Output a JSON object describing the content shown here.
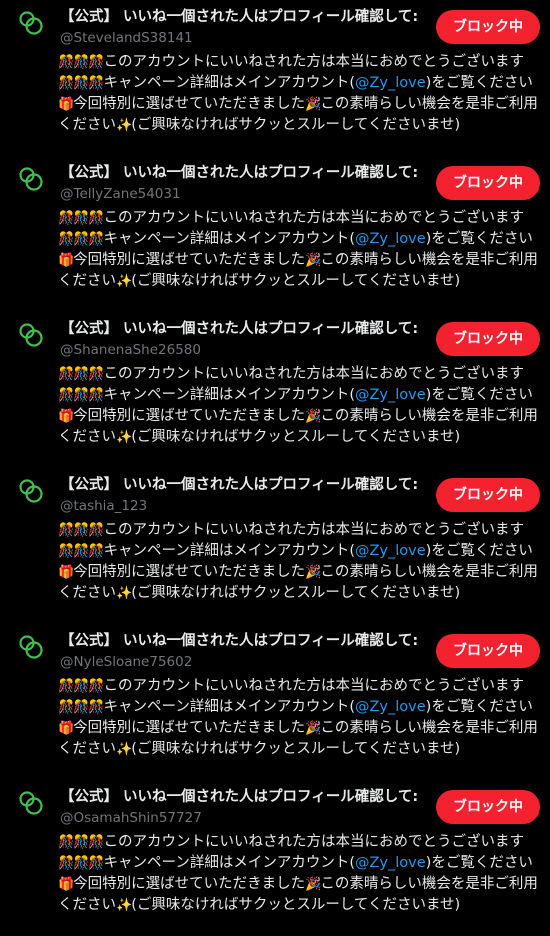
{
  "accounts": [
    {
      "name": "【公式】 いいね一個された人はプロフィール確認して:",
      "handle": "@StevelandS38141",
      "button_label": "ブロック中"
    },
    {
      "name": "【公式】 いいね一個された人はプロフィール確認して:",
      "handle": "@TellyZane54031",
      "button_label": "ブロック中"
    },
    {
      "name": "【公式】 いいね一個された人はプロフィール確認して:",
      "handle": "@ShanenaShe26580",
      "button_label": "ブロック中"
    },
    {
      "name": "【公式】 いいね一個された人はプロフィール確認して:",
      "handle": "@tashia_123",
      "button_label": "ブロック中"
    },
    {
      "name": "【公式】 いいね一個された人はプロフィール確認して:",
      "handle": "@NyleSloane75602",
      "button_label": "ブロック中"
    },
    {
      "name": "【公式】 いいね一個された人はプロフィール確認して:",
      "handle": "@OsamahShin57727",
      "button_label": "ブロック中"
    }
  ],
  "bio": {
    "emoji_balloons": "🎊🎊🎊",
    "part1": "このアカウントにいいねされた方は本当におめでとうございます",
    "part2": "キャンペーン詳細はメインアカウント(",
    "mention": "@Zy_love",
    "part3": ")をご覧ください",
    "emoji_gift": "🎁",
    "part4": "今回特別に選ばせていただきました",
    "emoji_party": "🎉",
    "part5": "この素晴らしい機会を是非ご利用ください",
    "emoji_sparkles": "✨",
    "part6": "(ご興味なければサクッとスルーしてくださいませ)"
  },
  "colors": {
    "background": "#000000",
    "text": "#e7e9ea",
    "handle": "#71767b",
    "button": "#f4212e",
    "mention": "#1d9bf0",
    "avatar_ring": "#3fbf4f"
  }
}
